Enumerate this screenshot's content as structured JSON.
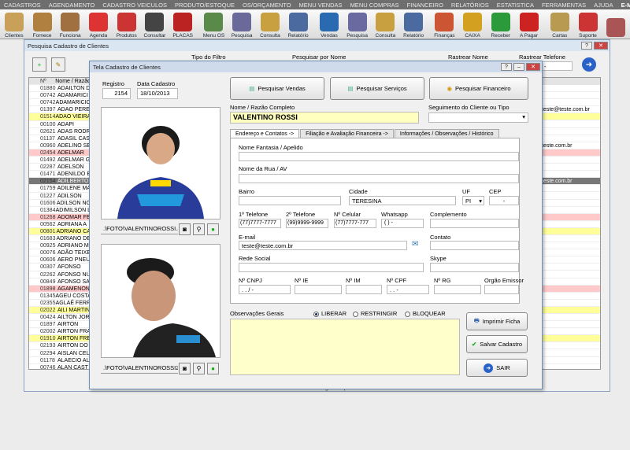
{
  "menu": [
    "CADASTROS",
    "AGENDAMENTO",
    "CADASTRO VEICULOS",
    "PRODUTO/ESTOQUE",
    "OS/ORÇAMENTO",
    "MENU VENDAS",
    "MENU COMPRAS",
    "FINANCEIRO",
    "RELATÓRIOS",
    "ESTATISTICA",
    "FERRAMENTAS",
    "AJUDA"
  ],
  "menu_email": "E-MAIL",
  "toolbar": [
    {
      "l": "Clientes",
      "c": "#c8a05a"
    },
    {
      "l": "Fornece",
      "c": "#b08040"
    },
    {
      "l": "Funciona",
      "c": "#a07040"
    },
    {
      "l": "Agenda",
      "c": "#d33"
    },
    {
      "l": "Produtos",
      "c": "#c33"
    },
    {
      "l": "Consultar",
      "c": "#444"
    },
    {
      "l": "PLACAS",
      "c": "#b22"
    },
    {
      "l": "Menu OS",
      "c": "#5a8a4a"
    },
    {
      "l": "Pesquisa",
      "c": "#6a6a9a"
    },
    {
      "l": "Consulta",
      "c": "#c9a040"
    },
    {
      "l": "Relatório",
      "c": "#4a6aa0"
    },
    {
      "l": "Vendas",
      "c": "#2a6ab0"
    },
    {
      "l": "Pesquisa",
      "c": "#6a6aa0"
    },
    {
      "l": "Consulta",
      "c": "#c9a040"
    },
    {
      "l": "Relatório",
      "c": "#4a6aa0"
    },
    {
      "l": "Finanças",
      "c": "#c53"
    },
    {
      "l": "CAIXA",
      "c": "#d4a020"
    },
    {
      "l": "Receber",
      "c": "#2a9a3a"
    },
    {
      "l": "A Pagar",
      "c": "#c22"
    },
    {
      "l": "Cartas",
      "c": "#b89a50"
    },
    {
      "l": "Suporte",
      "c": "#c33"
    },
    {
      "l": "",
      "c": "#a55"
    }
  ],
  "search_window": {
    "title": "Pesquisa Cadastro de Clientes",
    "filter_label": "Tipo do Filtro",
    "search_name_label": "Pesquisar por Nome",
    "track_name_label": "Rastrear Nome",
    "track_phone_label": "Rastrear Telefone",
    "col_num": "Nº",
    "col_name": "Nome / Razão",
    "rows": [
      {
        "n": "01880",
        "name": "ADAILTON D",
        "c": ""
      },
      {
        "n": "00742",
        "name": "ADAMARICI",
        "c": ""
      },
      {
        "n": "00742",
        "name": "ADAMARICIO",
        "c": ""
      },
      {
        "n": "01397",
        "name": "ADAO PERE",
        "c": ""
      },
      {
        "n": "01514",
        "name": "ADAO VIEIRA",
        "c": "y"
      },
      {
        "n": "00100",
        "name": "ADAPI",
        "c": ""
      },
      {
        "n": "02621",
        "name": "ADAS RODR",
        "c": ""
      },
      {
        "n": "01137",
        "name": "ADASIL CAS",
        "c": ""
      },
      {
        "n": "00960",
        "name": "ADELINO SE",
        "c": ""
      },
      {
        "n": "02454",
        "name": "ADELMAR",
        "c": "p"
      },
      {
        "n": "01492",
        "name": "ADELMAR G",
        "c": ""
      },
      {
        "n": "02287",
        "name": "ADELSON",
        "c": ""
      },
      {
        "n": "01471",
        "name": "ADENILDO E",
        "c": ""
      },
      {
        "n": "02154",
        "name": "ADILBERTO",
        "c": "g"
      },
      {
        "n": "01759",
        "name": "ADILENE MA",
        "c": ""
      },
      {
        "n": "01227",
        "name": "ADILSON",
        "c": ""
      },
      {
        "n": "01606",
        "name": "ADILSON NO",
        "c": ""
      },
      {
        "n": "01384",
        "name": "ADIMILSON L",
        "c": ""
      },
      {
        "n": "01268",
        "name": "ADOMAR FE",
        "c": "p"
      },
      {
        "n": "00562",
        "name": "ADRIANA A",
        "c": ""
      },
      {
        "n": "00801",
        "name": "ADRIANO CA",
        "c": "y"
      },
      {
        "n": "01683",
        "name": "ADRIANO DE",
        "c": ""
      },
      {
        "n": "00925",
        "name": "ADRIANO M",
        "c": ""
      },
      {
        "n": "00076",
        "name": "ADÃO TEIXE",
        "c": ""
      },
      {
        "n": "00606",
        "name": "AERO PNEU",
        "c": ""
      },
      {
        "n": "00307",
        "name": "AFONSO",
        "c": ""
      },
      {
        "n": "02262",
        "name": "AFONSO NU",
        "c": ""
      },
      {
        "n": "00849",
        "name": "AFONSO SA",
        "c": ""
      },
      {
        "n": "01898",
        "name": "AGAMENON",
        "c": "p"
      },
      {
        "n": "01345",
        "name": "AGEU COSTA",
        "c": ""
      },
      {
        "n": "02355",
        "name": "AGLAÉ FERR",
        "c": ""
      },
      {
        "n": "02022",
        "name": "AILI MARTIN",
        "c": "y"
      },
      {
        "n": "00424",
        "name": "AILTON JOR",
        "c": ""
      },
      {
        "n": "01897",
        "name": "AIRTON",
        "c": ""
      },
      {
        "n": "02002",
        "name": "AIRTON FRA",
        "c": ""
      },
      {
        "n": "01910",
        "name": "AIRTON FRE",
        "c": "y"
      },
      {
        "n": "02193",
        "name": "AIRTON DO",
        "c": ""
      },
      {
        "n": "02294",
        "name": "AISLAN CEL",
        "c": ""
      },
      {
        "n": "01178",
        "name": "ALAECIO AL",
        "c": ""
      },
      {
        "n": "00746",
        "name": "ALAN CAST",
        "c": ""
      }
    ],
    "right_col": [
      "",
      "",
      "",
      "teste@teste.com.br",
      "",
      "",
      "",
      "",
      "teste.com.br",
      "",
      "",
      "",
      "",
      "teste.com.br",
      "",
      "",
      "",
      "",
      "",
      "",
      "",
      "",
      "",
      "",
      "",
      "",
      "",
      "",
      "",
      "",
      "",
      "",
      "",
      "",
      "",
      "",
      "",
      "",
      "",
      ""
    ],
    "footer": "Para localizar o Nome digite as primeiras letras"
  },
  "dialog": {
    "title": "Tela Cadastro de Clientes",
    "registro_label": "Registro",
    "registro": "2154",
    "data_label": "Data Cadastro",
    "data": "18/10/2013",
    "photo1_path": ".\\FOTO\\VALENTINOROSSI.J",
    "photo2_path": ".\\FOTO\\VALENTINOROSSI2",
    "btn_vendas": "Pesquisar Vendas",
    "btn_servicos": "Pesquisar Serviços",
    "btn_financeiro": "Pesquisar  Financeiro",
    "nome_label": "Nome / Razão Completo",
    "nome": "VALENTINO ROSSI",
    "segmento_label": "Seguimento do Cliente ou Tipo",
    "tabs": [
      "Endereço e Contatos ->",
      "Filiação e Avaliação Financeira ->",
      "Informações / Observações / Histórico"
    ],
    "fantasia_label": "Nome Fantasia / Apelido",
    "rua_label": "Nome da Rua / AV",
    "bairro_label": "Bairro",
    "cidade_label": "Cidade",
    "cidade": "TERESINA",
    "uf_label": "UF",
    "uf": "PI",
    "cep_label": "CEP",
    "cep": "-",
    "tel1_label": "1º Telefone",
    "tel1": "(77)7777-7777",
    "tel2_label": "2º Telefone",
    "tel2": "(99)9999-9999",
    "cel_label": "Nº Celular",
    "cel": "(77)7777-777",
    "whats_label": "Whatsapp",
    "whats": "(  )    -",
    "complemento_label": "Complemento",
    "email_label": "E-mail",
    "email": "teste@teste.com.br",
    "contato_label": "Contato",
    "rede_label": "Rede Social",
    "skype_label": "Skype",
    "cnpj_label": "Nº CNPJ",
    "cnpj": ".    .    /    -",
    "ie_label": "Nº IE",
    "im_label": "Nº IM",
    "cpf_label": "Nº CPF",
    "cpf": ".    .    -",
    "rg_label": "Nº RG",
    "orgao_label": "Orgão Emissor",
    "obs_label": "Observações Gerais",
    "radios": [
      "LIBERAR",
      "RESTRINGIR",
      "BLOQUEAR"
    ],
    "btn_imprimir": "Imprimir Ficha",
    "btn_salvar": "Salvar Cadastro",
    "btn_sair": "SAIR"
  }
}
